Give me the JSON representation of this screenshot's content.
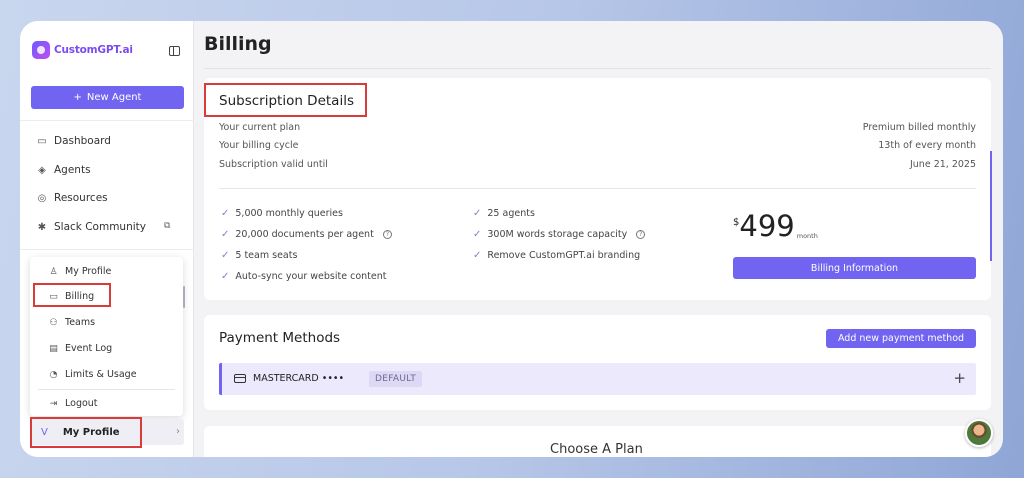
{
  "sidebar": {
    "logo_text": "CustomGPT.ai",
    "new_agent_label": "New Agent",
    "nav": [
      {
        "label": "Dashboard",
        "icon": "monitor-icon"
      },
      {
        "label": "Agents",
        "icon": "layers-icon"
      },
      {
        "label": "Resources",
        "icon": "lifebuoy-icon"
      },
      {
        "label": "Slack Community",
        "icon": "slack-icon"
      }
    ],
    "menu": [
      {
        "label": "My Profile",
        "icon": "user-icon"
      },
      {
        "label": "Billing",
        "icon": "credit-card-icon"
      },
      {
        "label": "Teams",
        "icon": "users-icon"
      },
      {
        "label": "Event Log",
        "icon": "archive-icon"
      },
      {
        "label": "Limits & Usage",
        "icon": "pie-chart-icon"
      },
      {
        "label": "Logout",
        "icon": "logout-icon"
      }
    ],
    "profile": {
      "avatar_letter": "V",
      "label": "My Profile"
    }
  },
  "page": {
    "title": "Billing"
  },
  "subscription": {
    "title": "Subscription Details",
    "rows": [
      {
        "label": "Your current plan",
        "value": "Premium billed monthly"
      },
      {
        "label": "Your billing cycle",
        "value": "13th of every month"
      },
      {
        "label": "Subscription valid until",
        "value": "June 21, 2025"
      }
    ],
    "features_left": [
      "5,000 monthly queries",
      "20,000 documents per agent",
      "5 team seats",
      "Auto-sync your website content"
    ],
    "features_right": [
      "25 agents",
      "300M words storage capacity",
      "Remove CustomGPT.ai branding"
    ],
    "price": {
      "currency": "$",
      "amount": "499",
      "period": "month"
    },
    "billing_button": "Billing Information"
  },
  "payment": {
    "title": "Payment Methods",
    "add_button": "Add new payment method",
    "method": {
      "name": "MASTERCARD ••••",
      "badge": "DEFAULT"
    }
  },
  "plans": {
    "title": "Choose A Plan"
  },
  "colors": {
    "accent": "#7064f0",
    "highlight": "#d93a3a"
  }
}
